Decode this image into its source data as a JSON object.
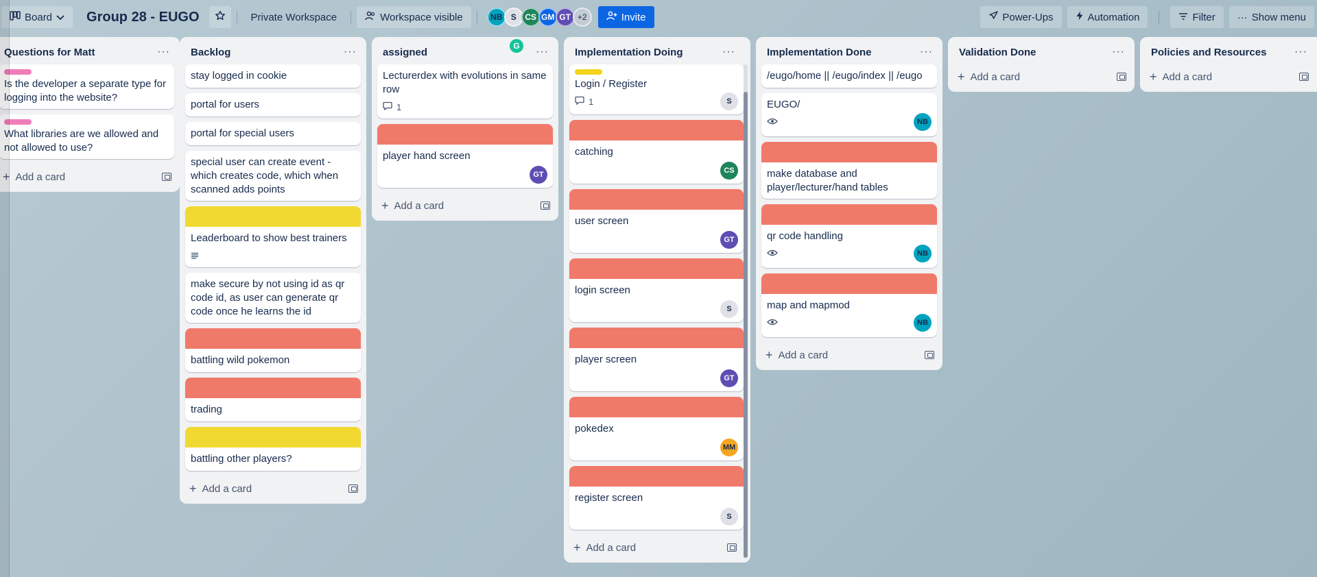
{
  "header": {
    "view_label": "Board",
    "board_title": "Group 28 - EUGO",
    "workspace_label": "Private Workspace",
    "visibility_label": "Workspace visible",
    "members": [
      "NB",
      "S",
      "CS",
      "GM",
      "GT"
    ],
    "members_more": "+2",
    "invite_label": "Invite",
    "powerups_label": "Power-Ups",
    "automation_label": "Automation",
    "filter_label": "Filter",
    "show_menu_label": "Show menu"
  },
  "add_card_label": "Add a card",
  "grammarly_letter": "G",
  "lists": [
    {
      "title": "Questions for Matt",
      "cards": [
        {
          "label_color": "pink",
          "text": "Is the developer a separate type for logging into the website?"
        },
        {
          "label_color": "pink",
          "text": "What libraries are we allowed and not allowed to use?"
        }
      ]
    },
    {
      "title": "Backlog",
      "cards": [
        {
          "text": "stay logged in cookie"
        },
        {
          "text": "portal for users"
        },
        {
          "text": "portal for special users"
        },
        {
          "text": "special user can create event - which creates code, which when scanned adds points"
        },
        {
          "cover": "yellow",
          "text": "Leaderboard to show best trainers",
          "description_icon": true
        },
        {
          "text": "make secure by not using id as qr code id, as user can generate qr code once he learns the id"
        },
        {
          "cover": "red",
          "text": "battling wild pokemon"
        },
        {
          "cover": "red",
          "text": "trading"
        },
        {
          "cover": "yellow",
          "text": "battling other players?"
        }
      ]
    },
    {
      "title": "assigned",
      "cards": [
        {
          "text": "Lecturerdex with evolutions in same row",
          "comments": "1"
        },
        {
          "cover": "red",
          "text": "player hand screen",
          "member": "GT"
        }
      ]
    },
    {
      "title": "Implementation Doing",
      "cards": [
        {
          "label_color": "yellow",
          "text": "Login / Register",
          "comments": "1",
          "member": "S"
        },
        {
          "cover": "red",
          "text": "catching",
          "member": "CS"
        },
        {
          "cover": "red",
          "text": "user screen",
          "member": "GT"
        },
        {
          "cover": "red",
          "text": "login screen",
          "member": "S"
        },
        {
          "cover": "red",
          "text": "player screen",
          "member": "GT"
        },
        {
          "cover": "red",
          "text": "pokedex",
          "member": "MM"
        },
        {
          "cover": "red",
          "text": "register screen",
          "member": "S"
        }
      ]
    },
    {
      "title": "Implementation Done",
      "cards": [
        {
          "text": "/eugo/home || /eugo/index || /eugo"
        },
        {
          "text": "EUGO/",
          "watch": true,
          "member": "NB"
        },
        {
          "cover": "red",
          "text": "make database and player/lecturer/hand tables"
        },
        {
          "cover": "red",
          "text": "qr code handling",
          "watch": true,
          "member": "NB"
        },
        {
          "cover": "red",
          "text": "map and mapmod",
          "watch": true,
          "member": "NB"
        }
      ]
    },
    {
      "title": "Validation Done",
      "cards": []
    },
    {
      "title": "Policies and Resources",
      "cards": []
    }
  ]
}
